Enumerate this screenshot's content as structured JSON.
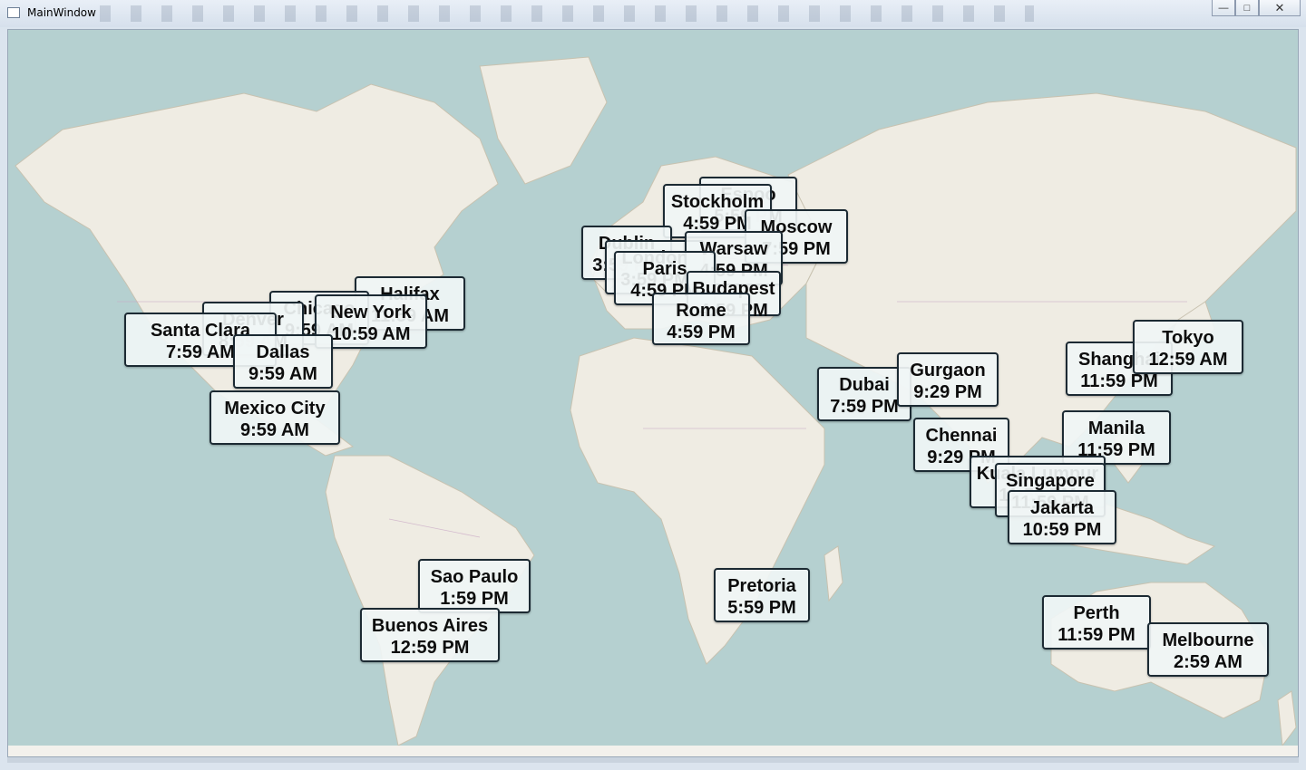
{
  "window": {
    "title": "MainWindow",
    "buttons": [
      "minimize",
      "maximize",
      "close"
    ]
  },
  "map": {
    "background": "#b5d0d0",
    "land": "#efece3"
  },
  "labels": [
    {
      "city": "Espoo",
      "time": "5:59 PM"
    },
    {
      "city": "Stockholm",
      "time": "4:59 PM"
    },
    {
      "city": "Moscow",
      "time": "7:59 PM"
    },
    {
      "city": "Dublin",
      "time": "3:59 PM"
    },
    {
      "city": "London",
      "time": "3:59 PM"
    },
    {
      "city": "Warsaw",
      "time": "4:59 PM"
    },
    {
      "city": "Paris",
      "time": "4:59 PM"
    },
    {
      "city": "Budapest",
      "time": "4:59 PM"
    },
    {
      "city": "Rome",
      "time": "4:59 PM"
    },
    {
      "city": "Halifax",
      "time": "11:59 AM"
    },
    {
      "city": "Chicago",
      "time": "9:59 AM"
    },
    {
      "city": "New York",
      "time": "10:59 AM"
    },
    {
      "city": "Denver",
      "time": "8:59 AM"
    },
    {
      "city": "Santa Clara",
      "time": "7:59 AM"
    },
    {
      "city": "Dallas",
      "time": "9:59 AM"
    },
    {
      "city": "Mexico City",
      "time": "9:59 AM"
    },
    {
      "city": "Sao Paulo",
      "time": "1:59 PM"
    },
    {
      "city": "Buenos Aires",
      "time": "12:59 PM"
    },
    {
      "city": "Pretoria",
      "time": "5:59 PM"
    },
    {
      "city": "Dubai",
      "time": "7:59 PM"
    },
    {
      "city": "Gurgaon",
      "time": "9:29 PM"
    },
    {
      "city": "Chennai",
      "time": "9:29 PM"
    },
    {
      "city": "Shanghai",
      "time": "11:59 PM"
    },
    {
      "city": "Tokyo",
      "time": "12:59 AM"
    },
    {
      "city": "Manila",
      "time": "11:59 PM"
    },
    {
      "city": "Kuala Lumpur",
      "time": "11:59 PM"
    },
    {
      "city": "Singapore",
      "time": "11:59 PM"
    },
    {
      "city": "Jakarta",
      "time": "10:59 PM"
    },
    {
      "city": "Perth",
      "time": "11:59 PM"
    },
    {
      "city": "Melbourne",
      "time": "2:59 AM"
    }
  ]
}
